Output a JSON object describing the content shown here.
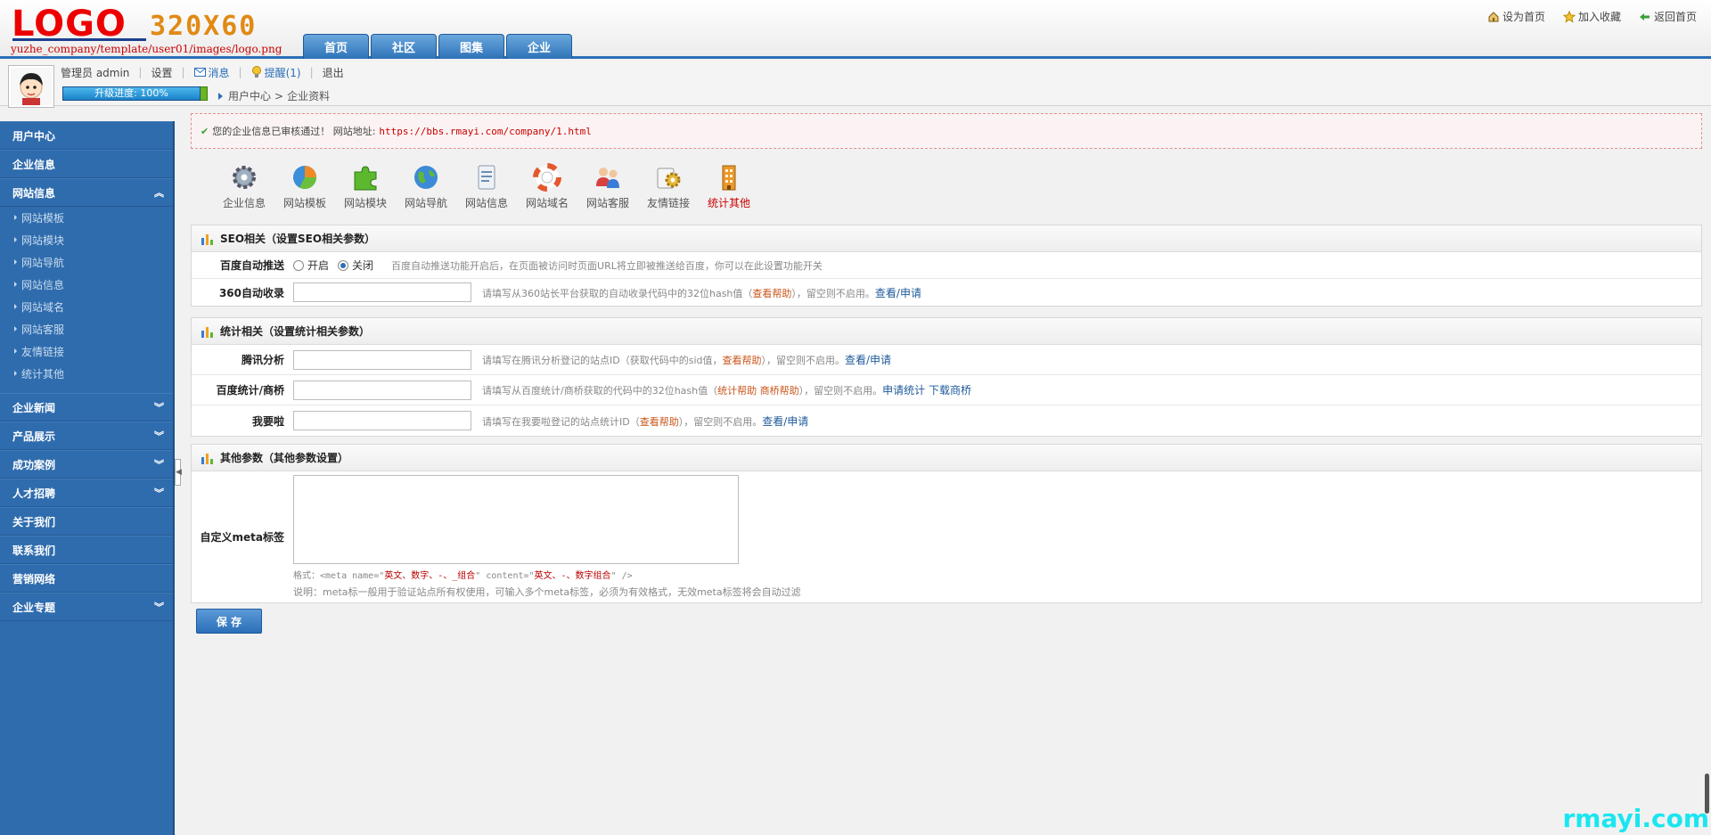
{
  "logo": {
    "text": "LOGO",
    "size": "320X60",
    "path": "yuzhe_company/template/user01/images/logo.png"
  },
  "nav": [
    {
      "label": "首页"
    },
    {
      "label": "社区"
    },
    {
      "label": "图集"
    },
    {
      "label": "企业"
    }
  ],
  "toplinks": {
    "home": "设为首页",
    "favorite": "加入收藏",
    "back": "返回首页"
  },
  "user": {
    "name": "管理员 admin",
    "settings": "设置",
    "messages": "消息",
    "reminders": "提醒(1)",
    "logout": "退出",
    "progress": "升级进度: 100%"
  },
  "breadcrumb": {
    "home": "用户中心",
    "current": "企业资料"
  },
  "sidebar": {
    "user_center": "用户中心",
    "company_info": "企业信息",
    "site_info": "网站信息",
    "site_info_items": [
      "网站模板",
      "网站模块",
      "网站导航",
      "网站信息",
      "网站域名",
      "网站客服",
      "友情链接",
      "统计其他"
    ],
    "news": "企业新闻",
    "products": "产品展示",
    "cases": "成功案例",
    "jobs": "人才招聘",
    "about": "关于我们",
    "contact": "联系我们",
    "marketing": "营销网络",
    "topics": "企业专题"
  },
  "notice": {
    "text": "您的企业信息已审核通过！ 网站地址:",
    "url": "https://bbs.rmayi.com/company/1.html"
  },
  "iconbar": [
    {
      "label": "企业信息",
      "icon": "gear-icon"
    },
    {
      "label": "网站模板",
      "icon": "pie-chart-icon"
    },
    {
      "label": "网站模块",
      "icon": "puzzle-icon"
    },
    {
      "label": "网站导航",
      "icon": "globe-icon"
    },
    {
      "label": "网站信息",
      "icon": "document-icon"
    },
    {
      "label": "网站域名",
      "icon": "lifebuoy-icon"
    },
    {
      "label": "网站客服",
      "icon": "users-icon"
    },
    {
      "label": "友情链接",
      "icon": "link-gear-icon"
    },
    {
      "label": "统计其他",
      "icon": "building-icon"
    }
  ],
  "seo": {
    "title": "SEO相关（设置SEO相关参数）",
    "baidu_push_label": "百度自动推送",
    "radio_on": "开启",
    "radio_off": "关闭",
    "baidu_push_tip": "百度自动推送功能开启后，在页面被访问时页面URL将立即被推送给百度，你可以在此设置功能开关",
    "s360_label": "360自动收录",
    "s360_tip_a": "请填写从360站长平台获取的自动收录代码中的32位hash值（",
    "s360_tip_help": "查看帮助",
    "s360_tip_b": "），留空则不启用。",
    "s360_tip_link": "查看/申请"
  },
  "stats": {
    "title": "统计相关（设置统计相关参数）",
    "tencent_label": "腾讯分析",
    "tencent_tip_a": "请填写在腾讯分析登记的站点ID（获取代码中的sid值，",
    "tencent_tip_help": "查看帮助",
    "tencent_tip_b": "），留空则不启用。",
    "tencent_tip_link": "查看/申请",
    "baidu_label": "百度统计/商桥",
    "baidu_tip_a": "请填写从百度统计/商桥获取的代码中的32位hash值（",
    "baidu_tip_help": "统计帮助 商桥帮助",
    "baidu_tip_b": "），留空则不启用。",
    "baidu_tip_link": "申请统计 下载商桥",
    "cnzz_label": "我要啦",
    "cnzz_tip_a": "请填写在我要啦登记的站点统计ID（",
    "cnzz_tip_help": "查看帮助",
    "cnzz_tip_b": "），留空则不启用。",
    "cnzz_tip_link": "查看/申请"
  },
  "other": {
    "title": "其他参数（其他参数设置）",
    "meta_label": "自定义meta标签",
    "format_a": "格式：<meta name=\"",
    "format_r1": "英文、数字、-、_组合",
    "format_b": "\" content=\"",
    "format_r2": "英文、-、数字组合",
    "format_c": "\" />",
    "desc": "说明：meta标一般用于验证站点所有权使用，可输入多个meta标签，必须为有效格式，无效meta标签将会自动过滤"
  },
  "save": "保 存",
  "watermark": "rmayi.com",
  "colors": {
    "primary": "#2f6cad",
    "accent": "#2a6fb8",
    "warning": "#c00000"
  }
}
